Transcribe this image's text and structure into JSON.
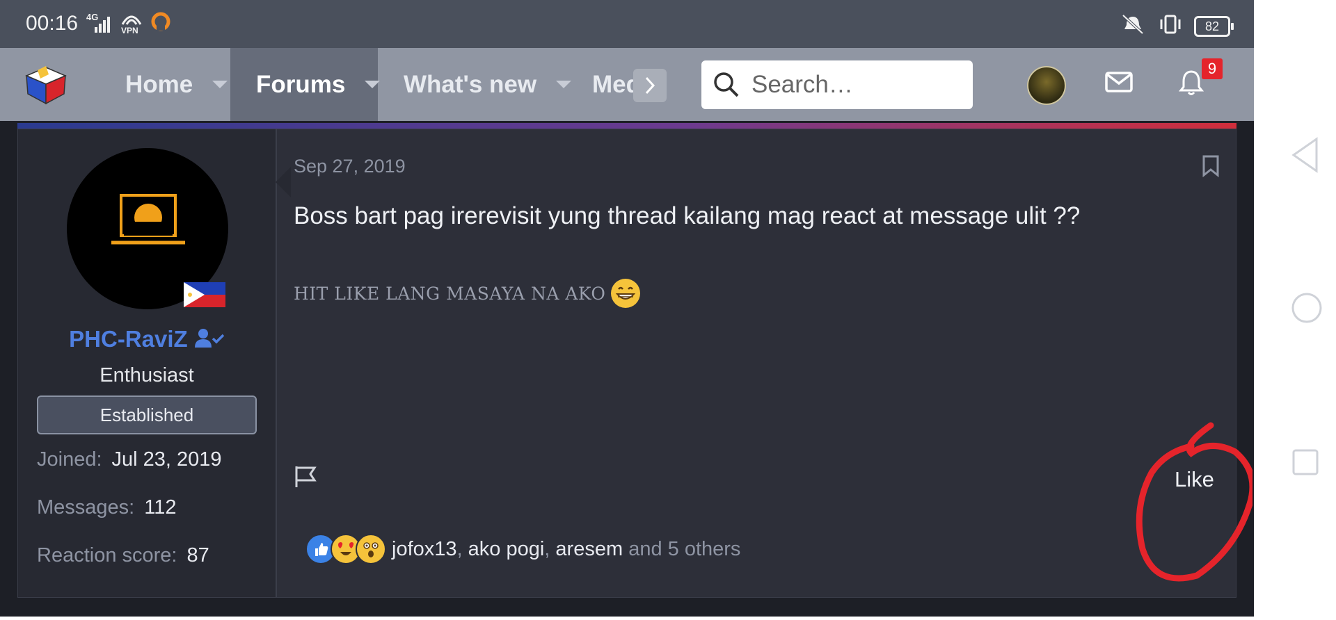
{
  "status_bar": {
    "time": "00:16",
    "network": "4G",
    "vpn": "VPN",
    "battery": "82",
    "icons_left": [
      "signal-icon",
      "vpn-icon",
      "headset-icon"
    ],
    "icons_right": [
      "mute-vibrate-icon",
      "vibrate-icon",
      "battery-icon"
    ]
  },
  "nav": {
    "tabs": [
      {
        "label": "Home",
        "active": false
      },
      {
        "label": "Forums",
        "active": true
      },
      {
        "label": "What's new",
        "active": false
      },
      {
        "label": "Media",
        "active": false
      }
    ],
    "search_placeholder": "Search…",
    "alerts_count": "9"
  },
  "post": {
    "user": {
      "name": "PHC-RaviZ",
      "title": "Enthusiast",
      "rank": "Established",
      "stats": [
        {
          "label": "Joined:",
          "value": "Jul 23, 2019"
        },
        {
          "label": "Messages:",
          "value": "112"
        },
        {
          "label": "Reaction score:",
          "value": "87"
        }
      ]
    },
    "date": "Sep 27, 2019",
    "body": "Boss bart pag irerevisit yung thread kailang mag react at message ulit ??",
    "signature": "HIT LIKE LANG MASAYA NA AKO",
    "like_label": "Like",
    "reactions": {
      "icons": [
        "like-reaction-icon",
        "love-reaction-icon",
        "wow-reaction-icon"
      ],
      "users": [
        "jofox13",
        "ako pogi",
        "aresem"
      ],
      "others_text": "and 5 others"
    }
  },
  "colors": {
    "username": "#4f7fe0",
    "annotation": "#e5242b",
    "alert_badge": "#e5242b",
    "nav_bg": "#9096a3"
  }
}
